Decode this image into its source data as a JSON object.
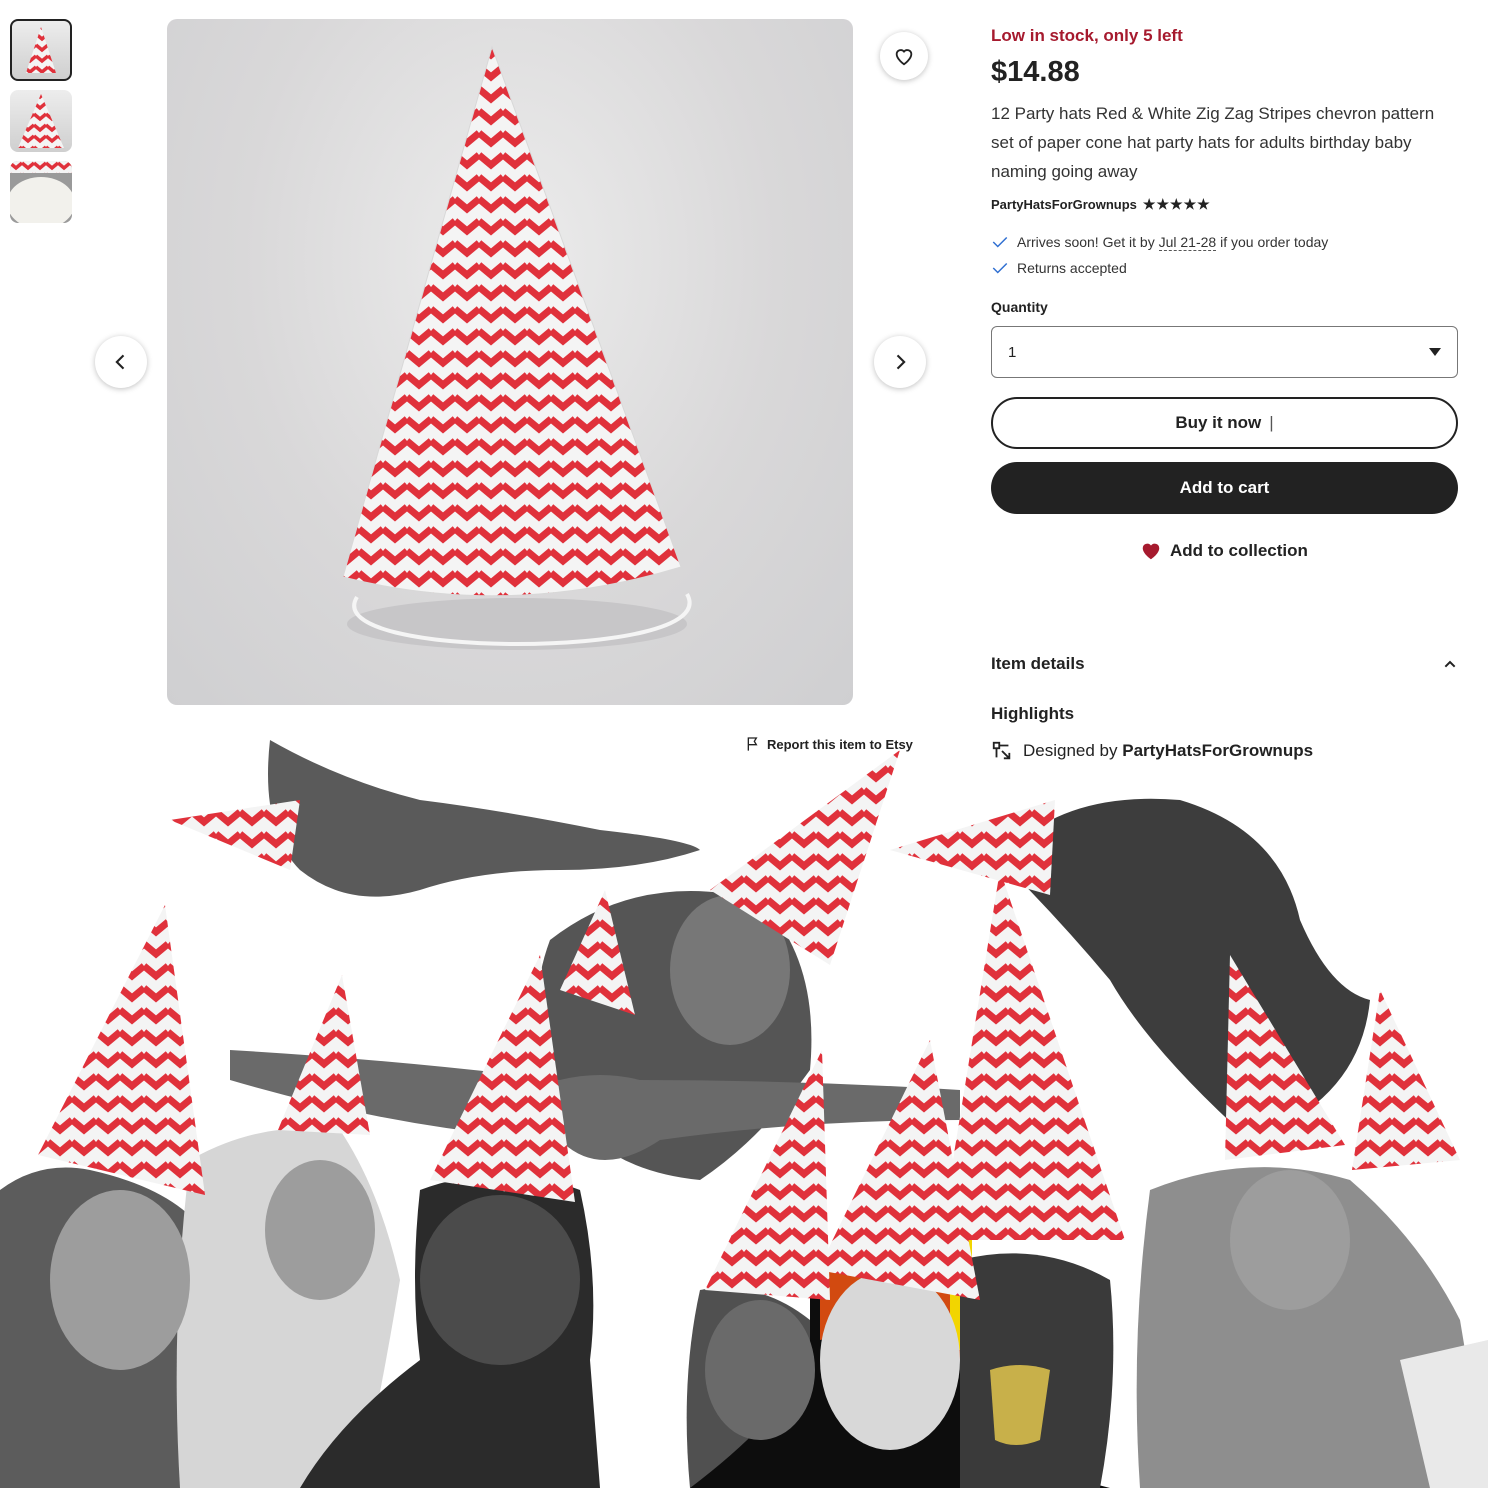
{
  "listing": {
    "stock_note": "Low in stock, only 5 left",
    "price": "$14.88",
    "title": "12 Party hats Red & White Zig Zag Stripes chevron pattern set of paper cone hat party hats for adults birthday baby naming going away",
    "shop_name": "PartyHatsForGrownups",
    "rating_stars": "★★★★★",
    "shipping_prefix": "Arrives soon! Get it by ",
    "shipping_date": "Jul 21-28",
    "shipping_suffix": " if you order today",
    "returns": "Returns accepted",
    "quantity_label": "Quantity",
    "quantity_value": "1",
    "buy_now_label": "Buy it now",
    "buy_now_cursor": "|",
    "add_to_cart_label": "Add to cart",
    "add_to_collection_label": "Add to collection",
    "item_details_label": "Item details",
    "highlights_label": "Highlights",
    "designed_by_prefix": "Designed by ",
    "designed_by_shop": "PartyHatsForGrownups",
    "report_label": "Report this item to Etsy"
  },
  "colors": {
    "stock_red": "#a61a2e",
    "hat_red": "#e0313b",
    "dark_button": "#222222",
    "check_blue": "#2f6fd1"
  },
  "icons": [
    "heart-outline-icon",
    "chevron-left-icon",
    "chevron-right-icon",
    "check-icon",
    "caret-down-icon",
    "heart-filled-icon",
    "chevron-up-icon",
    "flag-icon",
    "designer-icon"
  ]
}
